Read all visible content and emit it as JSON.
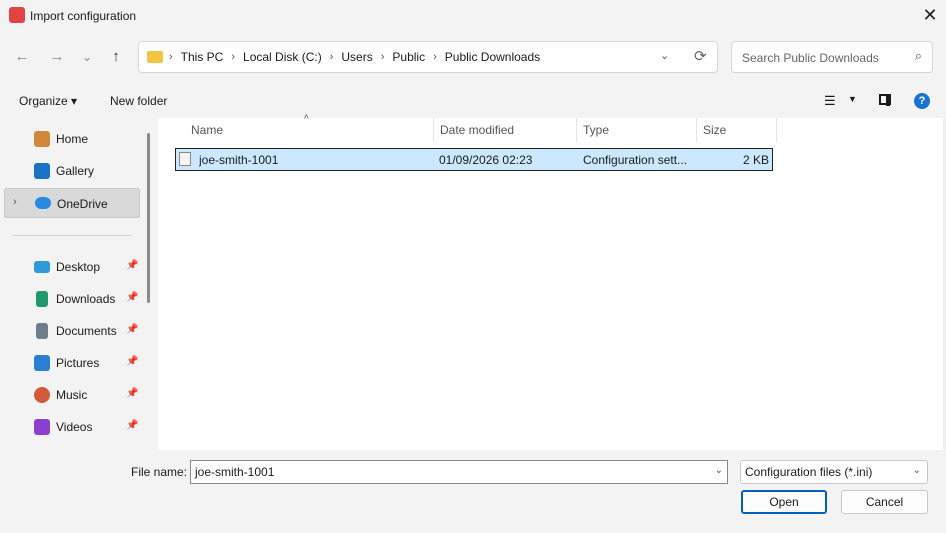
{
  "window": {
    "title": "Import configuration",
    "icon": "app-logo-icon",
    "close_glyph": "✕"
  },
  "nav_buttons": {
    "back_glyph": "←",
    "forward_glyph": "→",
    "recent_glyph": "⌄",
    "up_glyph": "↑"
  },
  "address": {
    "breadcrumbs": [
      "This PC",
      "Local Disk (C:)",
      "Users",
      "Public",
      "Public Downloads"
    ],
    "separator": "›",
    "dropdown_glyph": "⌄",
    "refresh_glyph": "⟳"
  },
  "search": {
    "placeholder": "Search Public Downloads",
    "icon_glyph": "⌕"
  },
  "toolbar": {
    "organize_label": "Organize ▾",
    "new_folder_label": "New folder",
    "view_glyph": "☰",
    "view_chevron": "▼",
    "help_glyph": "?"
  },
  "sidebar": {
    "expander_glyph": "›",
    "pin_glyph": "📌",
    "items": [
      {
        "label": "Home",
        "icon": "home-icon",
        "color": "#d2883a",
        "pinned": false
      },
      {
        "label": "Gallery",
        "icon": "gallery-icon",
        "color": "#1b73c7",
        "pinned": false
      },
      {
        "label": "OneDrive",
        "icon": "onedrive-icon",
        "color": "#2a8ae0",
        "pinned": false,
        "selected": true
      },
      {
        "label": "Desktop",
        "icon": "desktop-icon",
        "color": "#2e9bd6",
        "pinned": true
      },
      {
        "label": "Downloads",
        "icon": "downloads-icon",
        "color": "#1e9a6a",
        "pinned": true
      },
      {
        "label": "Documents",
        "icon": "documents-icon",
        "color": "#6f7c8a",
        "pinned": true
      },
      {
        "label": "Pictures",
        "icon": "pictures-icon",
        "color": "#2b7fd3",
        "pinned": true
      },
      {
        "label": "Music",
        "icon": "music-icon",
        "color": "#d45a3a",
        "pinned": true
      },
      {
        "label": "Videos",
        "icon": "videos-icon",
        "color": "#8a3fcf",
        "pinned": true
      }
    ]
  },
  "file_list": {
    "sort_glyph": "^",
    "columns": [
      "Name",
      "Date modified",
      "Type",
      "Size"
    ],
    "rows": [
      {
        "name": "joe-smith-1001",
        "date": "01/09/2026 02:23",
        "type": "Configuration sett...",
        "size": "2 KB",
        "selected": true
      }
    ]
  },
  "footer": {
    "file_name_label": "File name:",
    "file_name_value": "joe-smith-1001",
    "filter_value": "Configuration files (*.ini)",
    "dropdown_glyph": "⌄",
    "open_label": "Open",
    "cancel_label": "Cancel"
  },
  "colors": {
    "accent": "#005fb8",
    "selection": "#cce8ff",
    "help": "#1872d6",
    "app_icon": "#e0463f"
  }
}
